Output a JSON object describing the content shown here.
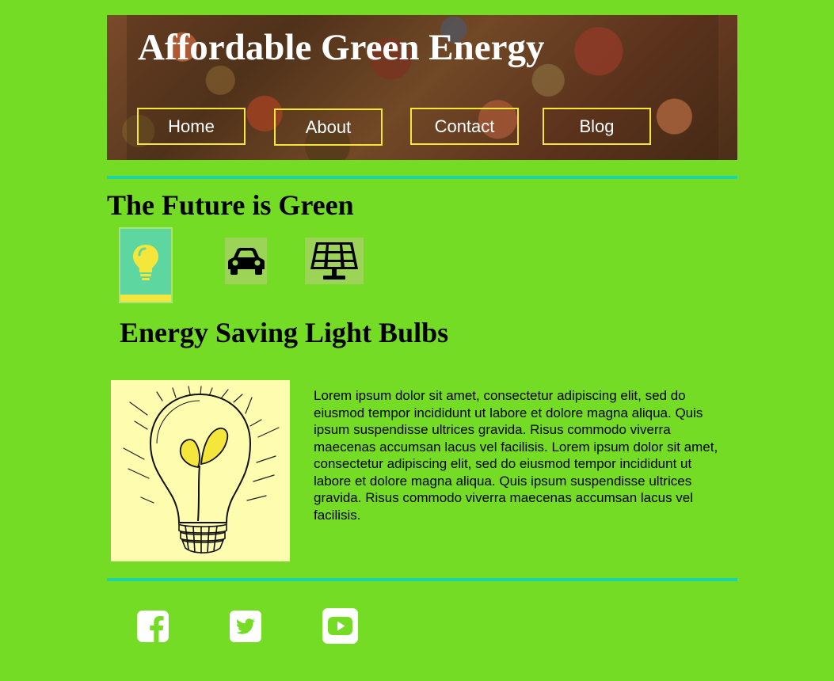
{
  "header": {
    "title": "Affordable Green Energy",
    "nav": [
      {
        "label": "Home"
      },
      {
        "label": "About"
      },
      {
        "label": "Contact"
      },
      {
        "label": "Blog"
      }
    ]
  },
  "main": {
    "section_title": "The Future is Green",
    "feature_icons": [
      "lightbulb-icon",
      "car-icon",
      "solar-panel-icon"
    ],
    "article": {
      "title": "Energy Saving Light Bulbs",
      "image": "lightbulb-sprout-illustration",
      "body": "Lorem ipsum dolor sit amet, consectetur adipiscing elit, sed do eiusmod tempor incididunt ut labore et dolore magna aliqua. Quis ipsum suspendisse ultrices gravida. Risus commodo viverra maecenas accumsan lacus vel facilisis. Lorem ipsum dolor sit amet, consectetur adipiscing elit, sed do eiusmod tempor incididunt ut labore et dolore magna aliqua. Quis ipsum suspendisse ultrices gravida. Risus commodo viverra maecenas accumsan lacus vel facilisis."
    }
  },
  "footer": {
    "social": [
      "facebook-icon",
      "twitter-icon",
      "youtube-icon"
    ]
  },
  "colors": {
    "background": "#74dc24",
    "divider": "#19d6a6",
    "nav_border": "#f5e73a",
    "active_tab": "#5ed6a0",
    "active_tab_bar": "#f5e63c",
    "tab": "#9bd457",
    "image_bg": "#fefcae"
  }
}
